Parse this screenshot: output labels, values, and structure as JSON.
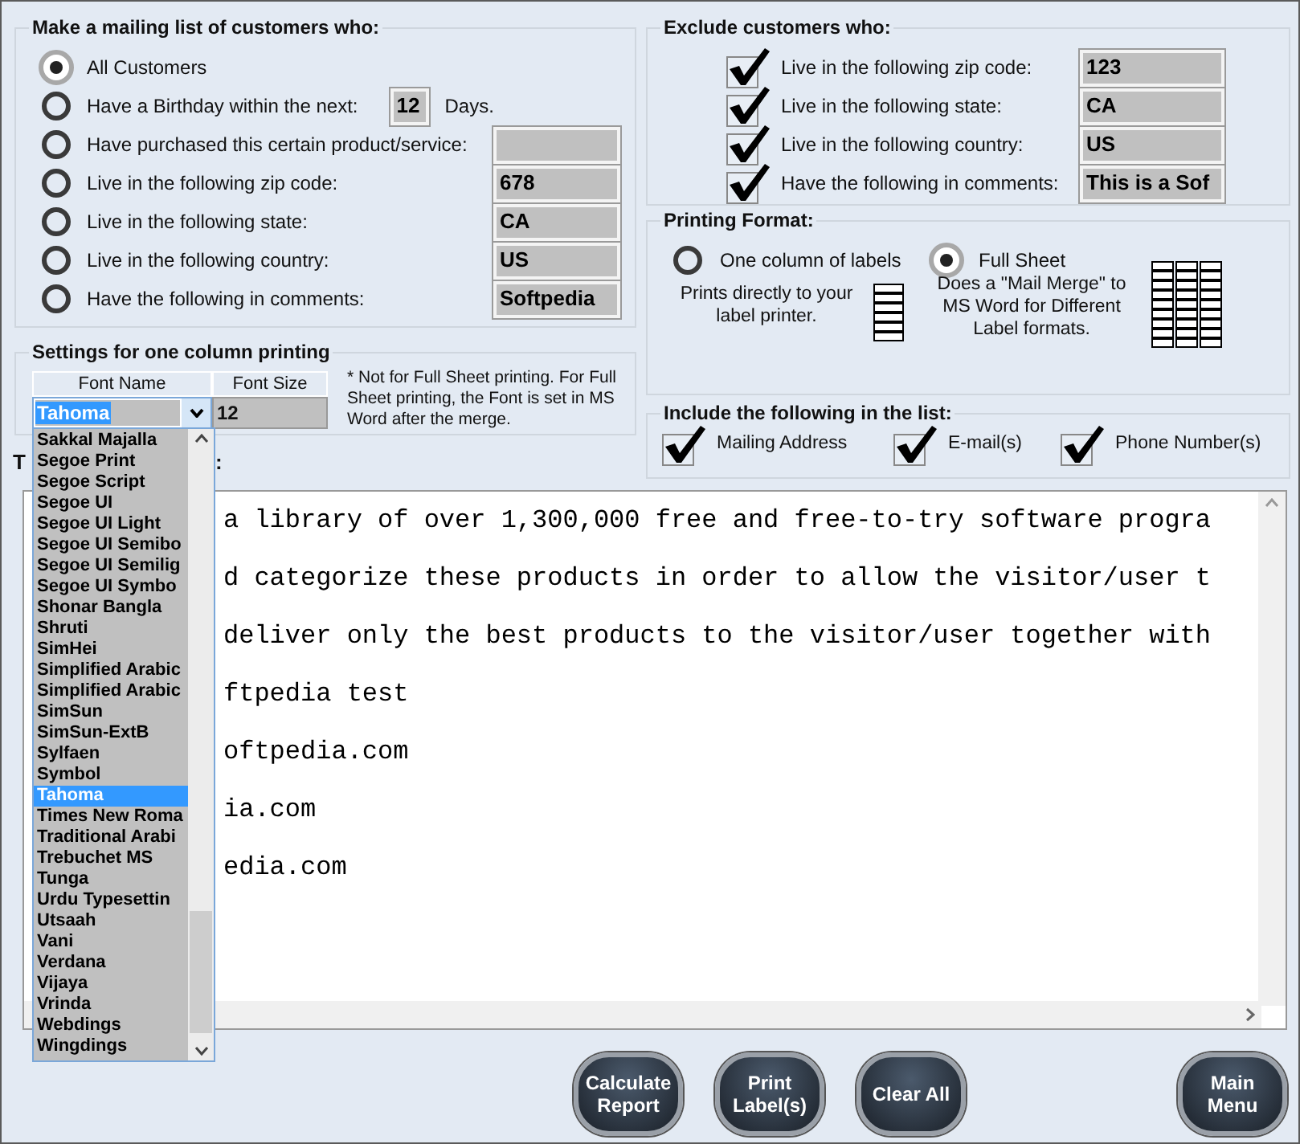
{
  "mailing_list": {
    "title": "Make a mailing list of customers who:",
    "options": [
      {
        "kind": "plain",
        "label": "All Customers",
        "selected": true
      },
      {
        "kind": "days",
        "label": "Have a Birthday within the next:",
        "selected": false,
        "value": "12",
        "suffix": "Days."
      },
      {
        "kind": "field",
        "label": "Have purchased this certain product/service:",
        "selected": false
      },
      {
        "kind": "field",
        "label": "Live in the following zip code:",
        "selected": false,
        "value": "678"
      },
      {
        "kind": "field",
        "label": "Live in the following state:",
        "selected": false,
        "value": "CA"
      },
      {
        "kind": "field",
        "label": "Live in the following country:",
        "selected": false,
        "value": "US"
      },
      {
        "kind": "field",
        "label": "Have the following in comments:",
        "selected": false,
        "value": "Softpedia"
      }
    ]
  },
  "settings": {
    "title": "Settings for one column printing",
    "columns": [
      "Font Name",
      "Font Size"
    ],
    "font_name": "Tahoma",
    "font_size": "12",
    "note": "* Not for Full Sheet  printing. For Full Sheet printing, the Font is set in MS Word after the merge.",
    "font_options": [
      {
        "label": "Sakkal Majalla",
        "selected": false
      },
      {
        "label": "Segoe Print",
        "selected": false
      },
      {
        "label": "Segoe Script",
        "selected": false
      },
      {
        "label": "Segoe UI",
        "selected": false
      },
      {
        "label": "Segoe UI Light",
        "selected": false
      },
      {
        "label": "Segoe UI Semibo",
        "selected": false
      },
      {
        "label": "Segoe UI Semilig",
        "selected": false
      },
      {
        "label": "Segoe UI Symbo",
        "selected": false
      },
      {
        "label": "Shonar Bangla",
        "selected": false
      },
      {
        "label": "Shruti",
        "selected": false
      },
      {
        "label": "SimHei",
        "selected": false
      },
      {
        "label": "Simplified Arabic",
        "selected": false
      },
      {
        "label": "Simplified Arabic",
        "selected": false
      },
      {
        "label": "SimSun",
        "selected": false
      },
      {
        "label": "SimSun-ExtB",
        "selected": false
      },
      {
        "label": "Sylfaen",
        "selected": false
      },
      {
        "label": "Symbol",
        "selected": false
      },
      {
        "label": "Tahoma",
        "selected": true
      },
      {
        "label": "Times New Roma",
        "selected": false
      },
      {
        "label": "Traditional Arabi",
        "selected": false
      },
      {
        "label": "Trebuchet MS",
        "selected": false
      },
      {
        "label": "Tunga",
        "selected": false
      },
      {
        "label": "Urdu Typesettin",
        "selected": false
      },
      {
        "label": "Utsaah",
        "selected": false
      },
      {
        "label": "Vani",
        "selected": false
      },
      {
        "label": "Verdana",
        "selected": false
      },
      {
        "label": "Vijaya",
        "selected": false
      },
      {
        "label": "Vrinda",
        "selected": false
      },
      {
        "label": "Webdings",
        "selected": false
      },
      {
        "label": "Wingdings",
        "selected": false
      }
    ]
  },
  "exclude": {
    "title": "Exclude customers who:",
    "items": [
      {
        "label": "Live in the following zip code:",
        "checked": true,
        "value": "123"
      },
      {
        "label": "Live in the following state:",
        "checked": true,
        "value": "CA"
      },
      {
        "label": "Live in the following country:",
        "checked": true,
        "value": "US"
      },
      {
        "label": "Have the following in comments:",
        "checked": true,
        "value": "This is a Sof"
      }
    ]
  },
  "printing_format": {
    "title": "Printing Format:",
    "options": [
      {
        "kind": "column",
        "label": "One column of labels",
        "selected": false,
        "description": "Prints directly to your label printer."
      },
      {
        "kind": "sheet",
        "label": "Full Sheet",
        "selected": true,
        "description": "Does a \"Mail Merge\" to MS Word for Different Label formats."
      }
    ]
  },
  "include": {
    "title": "Include the following in the list:",
    "items": [
      {
        "label": "Mailing Address",
        "checked": true
      },
      {
        "label": "E-mail(s)",
        "checked": true
      },
      {
        "label": "Phone Number(s)",
        "checked": true
      }
    ]
  },
  "text_section": {
    "label_start": "T",
    "label_end": ":",
    "lines": [
      {
        "rest": "a library of over 1,300,000 free and free-to-try software progra"
      },
      {
        "rest": "d categorize these products in order to allow the visitor/user t"
      },
      {
        "rest": "deliver only the best products to the visitor/user together with"
      },
      {
        "rest": "ftpedia test"
      },
      {
        "rest": "oftpedia.com"
      },
      {
        "rest": "ia.com"
      },
      {
        "rest": "edia.com"
      }
    ]
  },
  "buttons": [
    {
      "lines": [
        "Calculate",
        "Report"
      ]
    },
    {
      "lines": [
        "Print",
        "Label(s)"
      ]
    },
    {
      "lines": [
        "Clear All"
      ]
    },
    {
      "lines": [
        "Main",
        "Menu"
      ]
    }
  ]
}
